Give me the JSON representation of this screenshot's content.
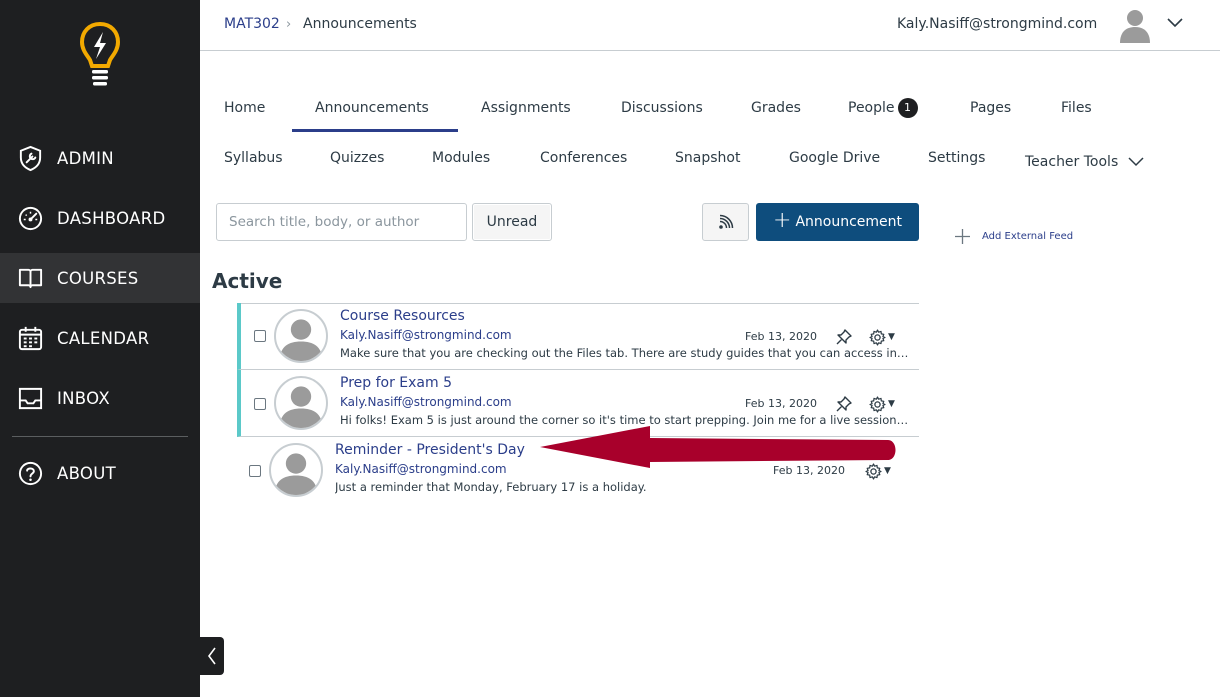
{
  "sidebar": {
    "items": [
      {
        "label": "ADMIN",
        "icon": "shield-wrench-icon"
      },
      {
        "label": "DASHBOARD",
        "icon": "gauge-icon"
      },
      {
        "label": "COURSES",
        "icon": "book-icon"
      },
      {
        "label": "CALENDAR",
        "icon": "calendar-icon"
      },
      {
        "label": "INBOX",
        "icon": "inbox-icon"
      },
      {
        "label": "ABOUT",
        "icon": "question-icon"
      }
    ],
    "active": "COURSES",
    "accent_color": "#f2a900"
  },
  "header": {
    "course": "MAT302",
    "current": "Announcements",
    "user_email": "Kaly.Nasiff@strongmind.com"
  },
  "tabs": {
    "items": [
      "Home",
      "Announcements",
      "Assignments",
      "Discussions",
      "Grades",
      "People",
      "Pages",
      "Files",
      "Syllabus",
      "Quizzes",
      "Modules",
      "Conferences",
      "Snapshot",
      "Google Drive",
      "Settings",
      "Teacher Tools"
    ],
    "active": "Announcements",
    "people_badge": "1"
  },
  "toolbar": {
    "search_placeholder": "Search title, body, or author",
    "unread_label": "Unread",
    "announcement_label": "Announcement",
    "external_feed_label": "Add External Feed",
    "primary_color": "#0e4d7d"
  },
  "section": {
    "title": "Active"
  },
  "announcements": [
    {
      "title": "Course Resources",
      "author": "Kaly.Nasiff@strongmind.com",
      "date": "Feb 13, 2020",
      "snippet": "Make sure that you are checking out the Files tab. There are study guides that you can access in that folder to help you prepare.",
      "unread": true,
      "pinned": true
    },
    {
      "title": "Prep for Exam 5",
      "author": "Kaly.Nasiff@strongmind.com",
      "date": "Feb 13, 2020",
      "snippet": "Hi folks! Exam 5 is just around the corner so it's time to start prepping. Join me for a live session on Thursday.",
      "unread": true,
      "pinned": true
    },
    {
      "title": "Reminder - President's Day",
      "author": "Kaly.Nasiff@strongmind.com",
      "date": "Feb 13, 2020",
      "snippet": "Just a reminder that Monday, February 17 is a holiday.",
      "unread": false,
      "pinned": false
    }
  ],
  "annotation": {
    "arrow_color": "#a8002b"
  }
}
